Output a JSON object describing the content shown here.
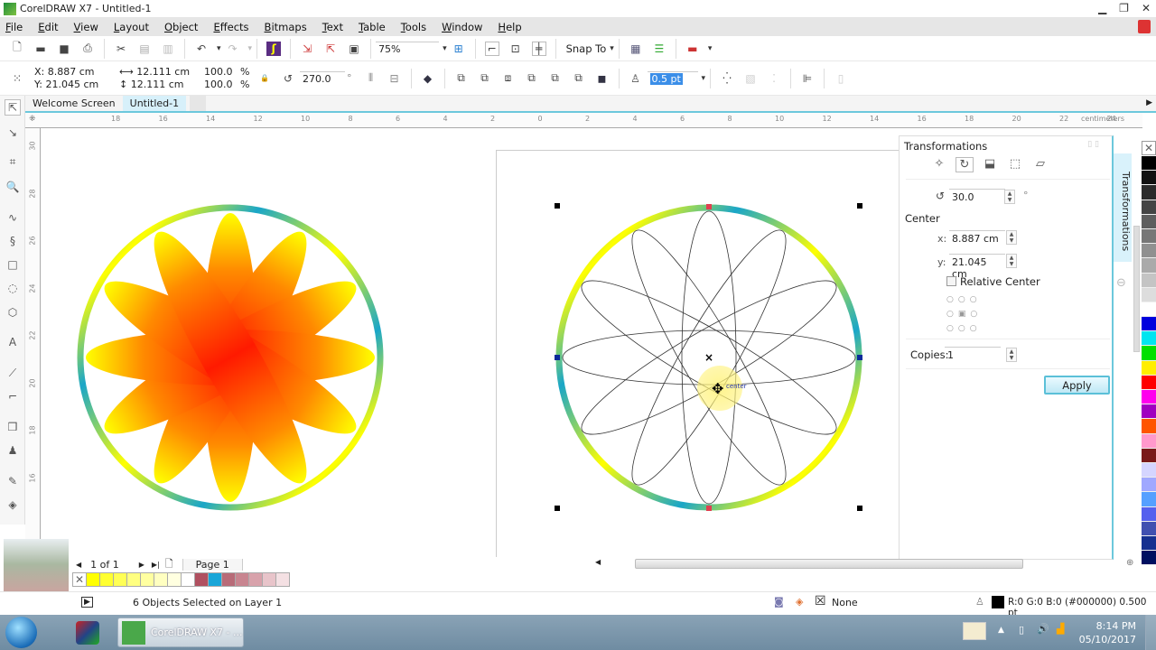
{
  "window": {
    "title": "CorelDRAW X7 - Untitled-1",
    "controls": [
      "minimize-icon",
      "restore-icon",
      "close-icon"
    ]
  },
  "menubar": {
    "items": [
      "File",
      "Edit",
      "View",
      "Layout",
      "Object",
      "Effects",
      "Bitmaps",
      "Text",
      "Table",
      "Tools",
      "Window",
      "Help"
    ]
  },
  "standard_toolbar": {
    "icons": [
      "new-icon",
      "open-icon",
      "save-icon",
      "print-icon",
      "cut-icon",
      "copy-icon",
      "paste-icon",
      "undo-icon",
      "redo-icon",
      "search-content-icon",
      "import-icon",
      "export-icon",
      "publish-pdf-icon"
    ],
    "zoom_level": "75%",
    "snap_to_label": "Snap To"
  },
  "property_bar": {
    "x": "X: 8.887 cm",
    "y": "Y: 21.045 cm",
    "width": "12.111 cm",
    "height": "12.111 cm",
    "scale_x": "100.0",
    "scale_y": "100.0",
    "percent": "%",
    "rotation": "270.0",
    "degree": "°",
    "outline_width": "0.5 pt"
  },
  "doc_tabs": [
    {
      "label": "Welcome Screen",
      "active": false
    },
    {
      "label": "Untitled-1",
      "active": true
    }
  ],
  "ruler": {
    "units": "centimeters",
    "h_ticks": [
      "18",
      "16",
      "14",
      "12",
      "10",
      "8",
      "6",
      "4",
      "2",
      "0",
      "2",
      "4",
      "6",
      "8",
      "10",
      "12",
      "14",
      "16",
      "18",
      "20",
      "22",
      "24"
    ],
    "v_ticks": [
      "30",
      "28",
      "26",
      "24",
      "22",
      "20",
      "18",
      "16"
    ]
  },
  "toolbox": {
    "tools": [
      "pick-tool-icon",
      "shape-tool-icon",
      "crop-tool-icon",
      "zoom-tool-icon",
      "freehand-tool-icon",
      "artistic-media-icon",
      "rectangle-tool-icon",
      "ellipse-tool-icon",
      "polygon-tool-icon",
      "text-tool-icon",
      "parallel-dimension-icon",
      "connector-tool-icon",
      "drop-shadow-icon",
      "transparency-icon",
      "color-eyedropper-icon",
      "interactive-fill-icon"
    ]
  },
  "canvas": {
    "left_flower": {
      "petals": 12,
      "fill_colors": [
        "#ff1a00",
        "#ff8000",
        "#ffff00"
      ],
      "ring_colors": [
        "#ffff00",
        "#1aa6c8"
      ]
    },
    "right_drawing": {
      "ellipses": 6,
      "selection": "6 objects",
      "center_label": "center"
    }
  },
  "docker": {
    "title": "Transformations",
    "tab_label": "Transformations",
    "mode_icons": [
      "position-icon",
      "rotate-icon",
      "scale-mirror-icon",
      "size-icon",
      "skew-icon"
    ],
    "angle": "30.0",
    "degree": "°",
    "center_label": "Center",
    "x_label": "x:",
    "x_value": "8.887 cm",
    "y_label": "y:",
    "y_value": "21.045 cm",
    "relative_center_label": "Relative Center",
    "relative_center_checked": false,
    "copies_label": "Copies:",
    "copies_value": "1",
    "apply_label": "Apply"
  },
  "palette": {
    "colors": [
      "#000000",
      "#111111",
      "#2b2b2b",
      "#444444",
      "#5e5e5e",
      "#777777",
      "#909090",
      "#aaaaaa",
      "#c4c4c4",
      "#dddddd",
      "#ffffff",
      "#0000dd",
      "#00e5f0",
      "#00e000",
      "#ffee00",
      "#ff0000",
      "#ff00ee",
      "#a000c0",
      "#ff5500",
      "#ff99cc",
      "#7a1a1a",
      "#d5d5ff",
      "#a0a8ff",
      "#55a0ff",
      "#5560ee",
      "#4050b0",
      "#153090",
      "#001060"
    ]
  },
  "page_nav": {
    "page_count": "1 of 1",
    "page_tab": "Page 1"
  },
  "document_palette": {
    "colors": [
      "#ffff00",
      "#ffff30",
      "#ffff55",
      "#ffff80",
      "#ffffa0",
      "#ffffc0",
      "#ffffe0",
      "#ffffff",
      "#b05060",
      "#1aa6d8",
      "#b86b78",
      "#c88590",
      "#d8a2ab",
      "#e8c4ca",
      "#f4e0e3"
    ]
  },
  "status": {
    "selection": "6 Objects Selected on Layer 1",
    "fill_label": "None",
    "outline_info": "R:0 G:0 B:0 (#000000) 0.500 pt"
  },
  "taskbar": {
    "app_label": "CorelDRAW X7 - ...",
    "time": "8:14 PM",
    "date": "05/10/2017"
  }
}
